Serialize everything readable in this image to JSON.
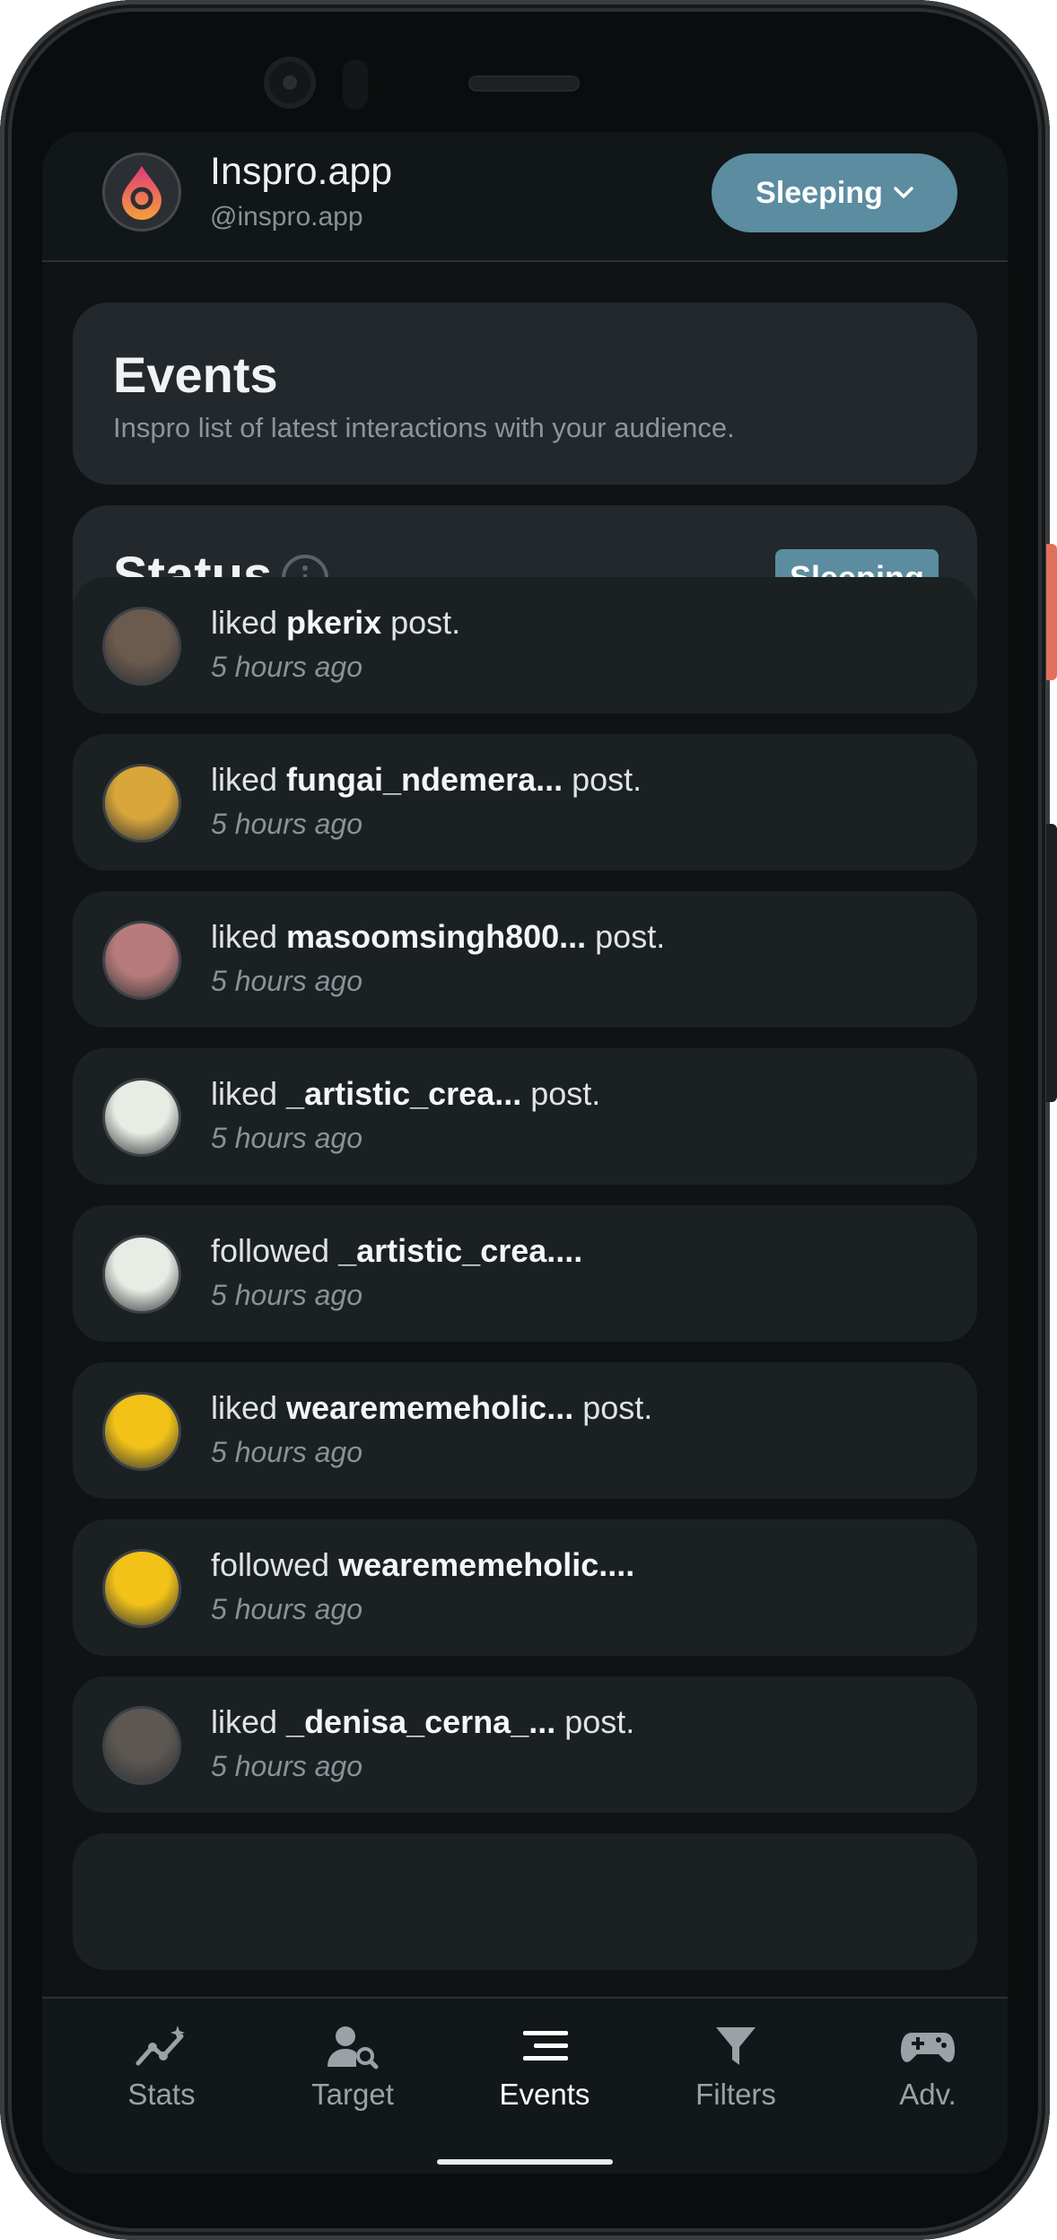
{
  "header": {
    "app_name": "Inspro.app",
    "handle": "@inspro.app",
    "status_button": "Sleeping",
    "logo_icon": "inspro-logo"
  },
  "events_card": {
    "title": "Events",
    "subtitle": "Inspro list of latest interactions with your audience."
  },
  "status_card": {
    "title": "Status",
    "badge": "Sleeping"
  },
  "events": [
    {
      "prefix": "liked ",
      "user": "pkerix",
      "suffix": " post.",
      "time": "5 hours ago",
      "avatar_color": "#6b5a4e"
    },
    {
      "prefix": "liked ",
      "user": "fungai_ndemera...",
      "suffix": " post.",
      "time": "5 hours ago",
      "avatar_color": "#d8a63a"
    },
    {
      "prefix": "liked ",
      "user": "masoomsingh800...",
      "suffix": " post.",
      "time": "5 hours ago",
      "avatar_color": "#b77b7b"
    },
    {
      "prefix": "liked ",
      "user": "_artistic_crea...",
      "suffix": " post.",
      "time": "5 hours ago",
      "avatar_color": "#e8ece4"
    },
    {
      "prefix": "followed ",
      "user": "_artistic_crea....",
      "suffix": "",
      "time": "5 hours ago",
      "avatar_color": "#e8ece4"
    },
    {
      "prefix": "liked ",
      "user": "wearememeholic...",
      "suffix": " post.",
      "time": "5 hours ago",
      "avatar_color": "#f2c218"
    },
    {
      "prefix": "followed ",
      "user": "wearememeholic....",
      "suffix": "",
      "time": "5 hours ago",
      "avatar_color": "#f2c218"
    },
    {
      "prefix": "liked ",
      "user": "_denisa_cerna_...",
      "suffix": " post.",
      "time": "5 hours ago",
      "avatar_color": "#5c5752"
    }
  ],
  "nav": {
    "items": [
      {
        "label": "Stats",
        "icon": "stats-icon"
      },
      {
        "label": "Target",
        "icon": "target-user-search-icon"
      },
      {
        "label": "Events",
        "icon": "events-list-icon"
      },
      {
        "label": "Filters",
        "icon": "filter-funnel-icon"
      },
      {
        "label": "Adv.",
        "icon": "gamepad-icon"
      }
    ],
    "active": "Events"
  },
  "colors": {
    "accent": "#5b8ca0",
    "background": "#0f1316",
    "card": "#22282c",
    "row": "#1b2023"
  }
}
